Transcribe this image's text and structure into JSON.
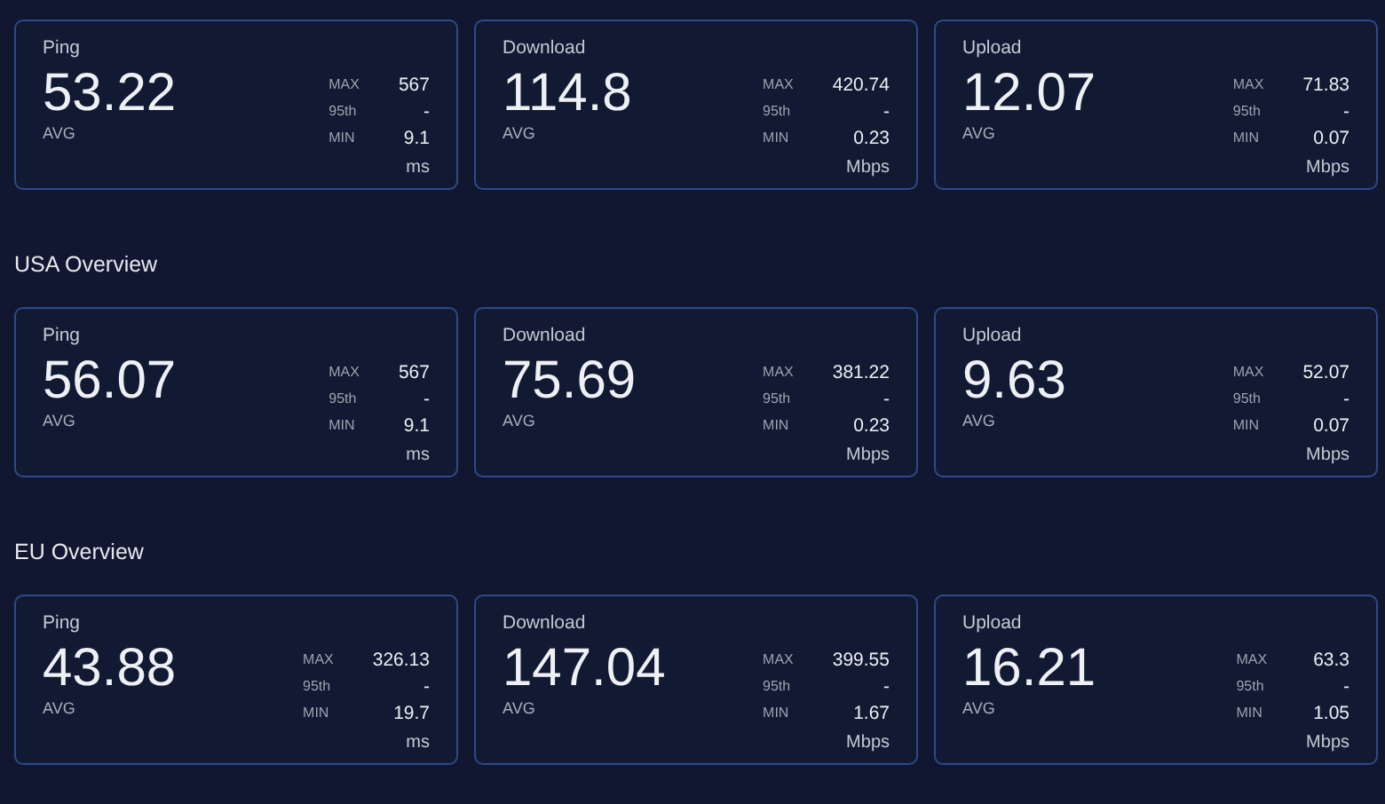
{
  "sections": [
    {
      "cards": [
        {
          "label": "Ping",
          "avg": "53.22",
          "avg_label": "AVG",
          "stats": [
            {
              "label": "MAX",
              "value": "567"
            },
            {
              "label": "95th",
              "value": "-"
            },
            {
              "label": "MIN",
              "value": "9.1"
            }
          ],
          "unit": "ms"
        },
        {
          "label": "Download",
          "avg": "114.8",
          "avg_label": "AVG",
          "stats": [
            {
              "label": "MAX",
              "value": "420.74"
            },
            {
              "label": "95th",
              "value": "-"
            },
            {
              "label": "MIN",
              "value": "0.23"
            }
          ],
          "unit": "Mbps"
        },
        {
          "label": "Upload",
          "avg": "12.07",
          "avg_label": "AVG",
          "stats": [
            {
              "label": "MAX",
              "value": "71.83"
            },
            {
              "label": "95th",
              "value": "-"
            },
            {
              "label": "MIN",
              "value": "0.07"
            }
          ],
          "unit": "Mbps"
        }
      ]
    },
    {
      "title": "USA Overview",
      "cards": [
        {
          "label": "Ping",
          "avg": "56.07",
          "avg_label": "AVG",
          "stats": [
            {
              "label": "MAX",
              "value": "567"
            },
            {
              "label": "95th",
              "value": "-"
            },
            {
              "label": "MIN",
              "value": "9.1"
            }
          ],
          "unit": "ms"
        },
        {
          "label": "Download",
          "avg": "75.69",
          "avg_label": "AVG",
          "stats": [
            {
              "label": "MAX",
              "value": "381.22"
            },
            {
              "label": "95th",
              "value": "-"
            },
            {
              "label": "MIN",
              "value": "0.23"
            }
          ],
          "unit": "Mbps"
        },
        {
          "label": "Upload",
          "avg": "9.63",
          "avg_label": "AVG",
          "stats": [
            {
              "label": "MAX",
              "value": "52.07"
            },
            {
              "label": "95th",
              "value": "-"
            },
            {
              "label": "MIN",
              "value": "0.07"
            }
          ],
          "unit": "Mbps"
        }
      ]
    },
    {
      "title": "EU Overview",
      "cards": [
        {
          "label": "Ping",
          "avg": "43.88",
          "avg_label": "AVG",
          "stats": [
            {
              "label": "MAX",
              "value": "326.13"
            },
            {
              "label": "95th",
              "value": "-"
            },
            {
              "label": "MIN",
              "value": "19.7"
            }
          ],
          "unit": "ms"
        },
        {
          "label": "Download",
          "avg": "147.04",
          "avg_label": "AVG",
          "stats": [
            {
              "label": "MAX",
              "value": "399.55"
            },
            {
              "label": "95th",
              "value": "-"
            },
            {
              "label": "MIN",
              "value": "1.67"
            }
          ],
          "unit": "Mbps"
        },
        {
          "label": "Upload",
          "avg": "16.21",
          "avg_label": "AVG",
          "stats": [
            {
              "label": "MAX",
              "value": "63.3"
            },
            {
              "label": "95th",
              "value": "-"
            },
            {
              "label": "MIN",
              "value": "1.05"
            }
          ],
          "unit": "Mbps"
        }
      ]
    }
  ]
}
